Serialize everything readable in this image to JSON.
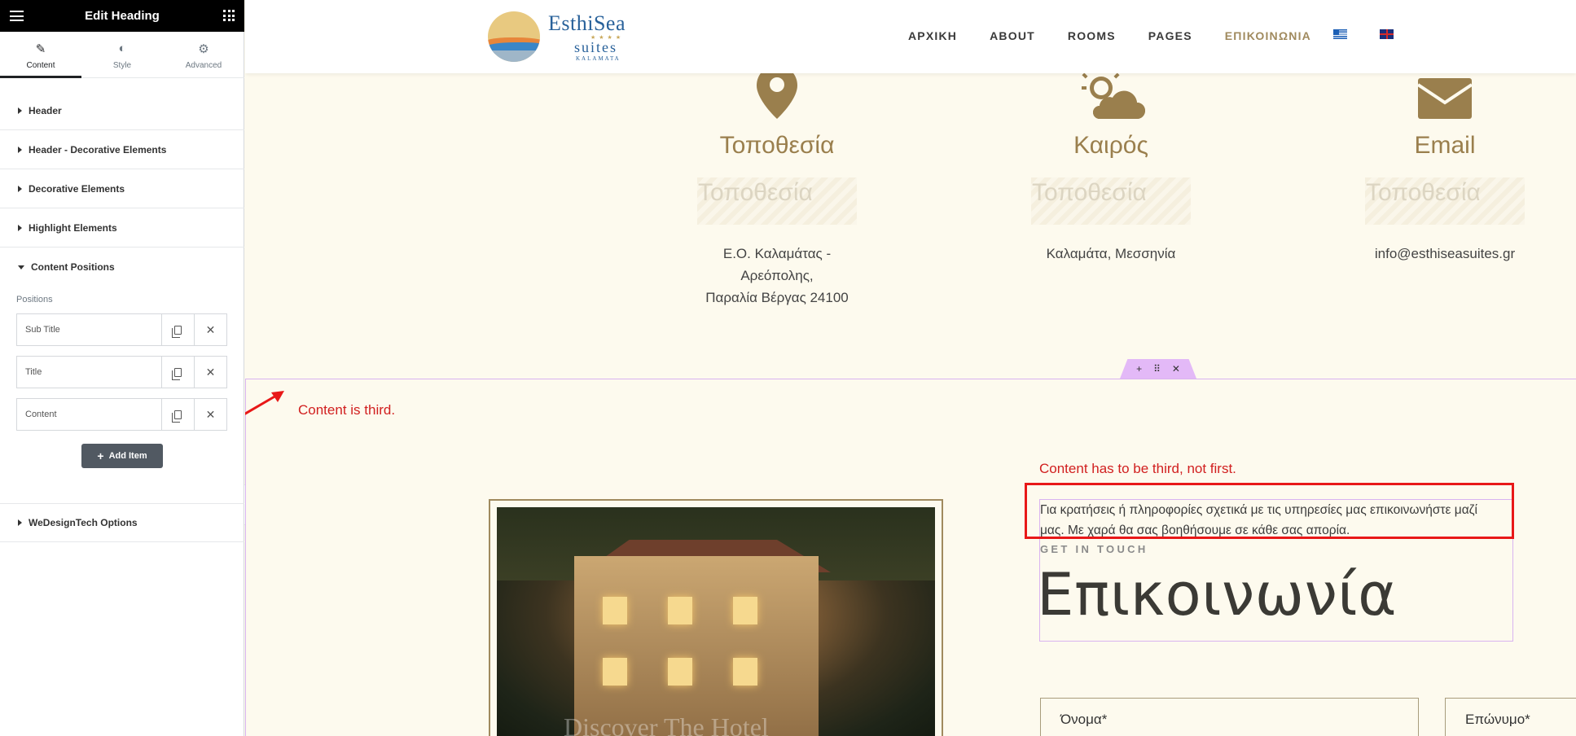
{
  "panel": {
    "title": "Edit Heading",
    "tabs": [
      {
        "label": "Content",
        "icon": "pencil-icon"
      },
      {
        "label": "Style",
        "icon": "half-circle-icon"
      },
      {
        "label": "Advanced",
        "icon": "gear-icon"
      }
    ],
    "sections": [
      "Header",
      "Header - Decorative Elements",
      "Decorative Elements",
      "Highlight Elements",
      "Content Positions"
    ],
    "positions_label": "Positions",
    "repeater_items": [
      "Sub Title",
      "Title",
      "Content"
    ],
    "add_item_label": "Add Item",
    "footer_section": "WeDesignTech Options"
  },
  "site": {
    "logo": {
      "brand": "EsthiSea",
      "stars": "★★★★",
      "suites": "suites",
      "location": "KALAMATA"
    },
    "nav": [
      "ΑΡΧΙΚΗ",
      "ABOUT",
      "ROOMS",
      "PAGES",
      "ΕΠΙΚΟΙΝΩΝΙΑ"
    ],
    "nav_active": "ΕΠΙΚΟΙΝΩΝΙΑ",
    "info_columns": [
      {
        "icon": "location-pin-icon",
        "title": "Τοποθεσία",
        "placeholder": "Τοποθεσία",
        "text": "Ε.Ο. Καλαμάτας -\nΑρεόπολης,\nΠαραλία Βέργας 24100"
      },
      {
        "icon": "weather-sun-cloud-icon",
        "title": "Καιρός",
        "placeholder": "Τοποθεσία",
        "text": "Καλαμάτα, Μεσσηνία"
      },
      {
        "icon": "envelope-icon",
        "title": "Email",
        "placeholder": "Τοποθεσία",
        "text": "info@esthiseasuites.gr"
      }
    ],
    "contact": {
      "content": "Για κρατήσεις ή πληροφορίες σχετικά με τις υπηρεσίες μας επικοινωνήστε μαζί μας. Με χαρά θα σας βοηθήσουμε σε κάθε σας απορία.",
      "subtitle": "GET IN TOUCH",
      "title": "Επικοινωνία"
    },
    "image_caption": "Discover The Hotel",
    "form": {
      "first_name": "Όνομα*",
      "last_name": "Επώνυμο*"
    }
  },
  "annotations": {
    "left": "Content is third.",
    "right": "Content has to be third, not first."
  },
  "colors": {
    "accent": "#a08a5e",
    "annotation": "#d11f1f",
    "page_bg": "#fdfaee",
    "editor_dark": "#000000"
  }
}
